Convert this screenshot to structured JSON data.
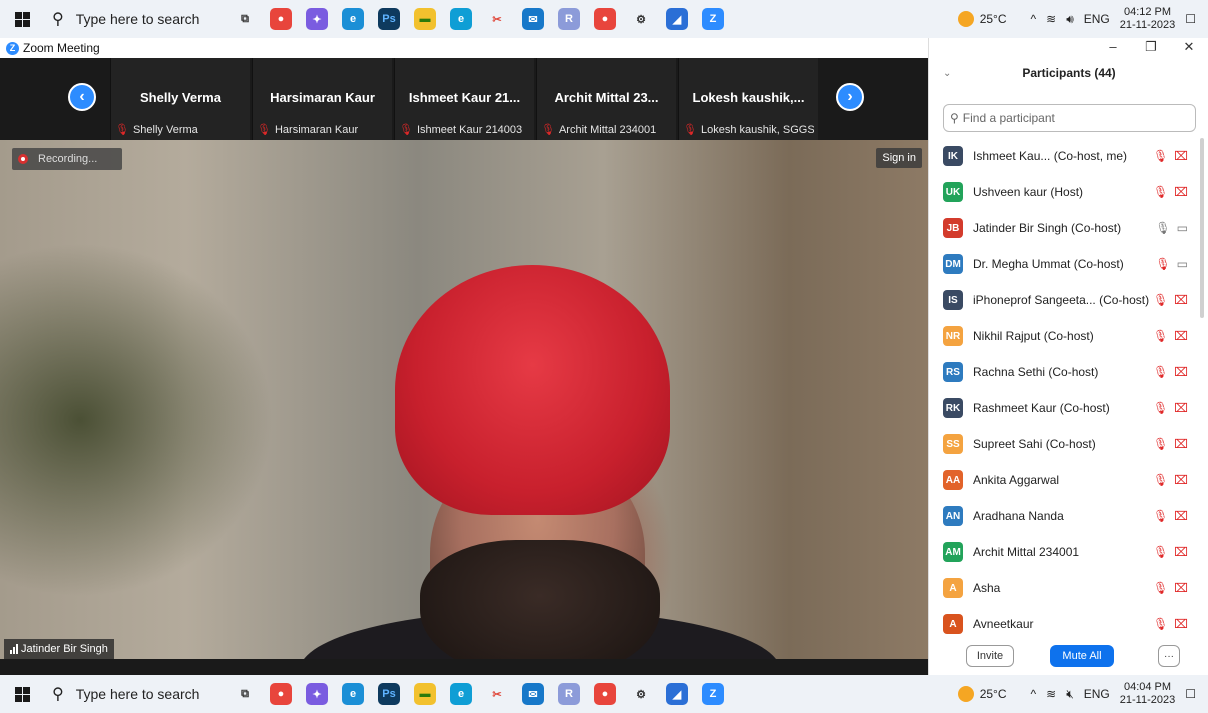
{
  "taskbar_top": {
    "search_placeholder": "Type here to search",
    "temperature": "25°C",
    "lang": "ENG",
    "time": "04:12 PM",
    "date": "21-11-2023"
  },
  "taskbar_bottom": {
    "search_placeholder": "Type here to search",
    "temperature": "25°C",
    "lang": "ENG",
    "time": "04:04 PM",
    "date": "21-11-2023"
  },
  "taskbar_icons": [
    "task-view-icon",
    "chrome-icon",
    "copilot-icon",
    "edge-icon",
    "photoshop-icon",
    "file-explorer-icon",
    "edge-browser-icon",
    "snipping-tool-icon",
    "mail-icon",
    "r-icon",
    "chrome-alt-icon",
    "settings-icon",
    "photos-icon",
    "zoom-icon"
  ],
  "window": {
    "title": "Zoom Meeting"
  },
  "strip": {
    "tiles": [
      {
        "name": "Shelly Verma",
        "label": "Shelly Verma"
      },
      {
        "name": "Harsimaran Kaur",
        "label": "Harsimaran Kaur"
      },
      {
        "name": "Ishmeet Kaur 21...",
        "label": "Ishmeet Kaur 214003"
      },
      {
        "name": "Archit Mittal 23...",
        "label": "Archit Mittal 234001"
      },
      {
        "name": "Lokesh kaushik,...",
        "label": "Lokesh kaushik, SGGS..."
      }
    ]
  },
  "video": {
    "recording_label": "Recording...",
    "signin_label": "Sign in",
    "speaker_name": "Jatinder Bir Singh"
  },
  "panel": {
    "title": "Participants (44)",
    "search_placeholder": "Find a participant",
    "participants": [
      {
        "initials": "IK",
        "name": "Ishmeet Kau...  (Co-host, me)",
        "color": "#3a4a63",
        "mic": "muted",
        "video": "off"
      },
      {
        "initials": "UK",
        "name": "Ushveen kaur (Host)",
        "color": "#22a35a",
        "mic": "muted",
        "video": "off"
      },
      {
        "initials": "JB",
        "name": "Jatinder Bir Singh (Co-host)",
        "color": "#d33b2c",
        "mic": "on",
        "video": "on"
      },
      {
        "initials": "DM",
        "name": "Dr. Megha Ummat (Co-host)",
        "color": "#2e7bbf",
        "mic": "muted",
        "video": "on"
      },
      {
        "initials": "IS",
        "name": "iPhoneprof Sangeeta... (Co-host)",
        "color": "#3a4a63",
        "mic": "muted",
        "video": "off"
      },
      {
        "initials": "NR",
        "name": "Nikhil Rajput (Co-host)",
        "color": "#f4a340",
        "mic": "muted",
        "video": "off"
      },
      {
        "initials": "RS",
        "name": "Rachna Sethi (Co-host)",
        "color": "#2e7bbf",
        "mic": "muted",
        "video": "off"
      },
      {
        "initials": "RK",
        "name": "Rashmeet Kaur (Co-host)",
        "color": "#3a4a63",
        "mic": "muted",
        "video": "off"
      },
      {
        "initials": "SS",
        "name": "Supreet Sahi (Co-host)",
        "color": "#f4a340",
        "mic": "muted",
        "video": "off"
      },
      {
        "initials": "AA",
        "name": "Ankita Aggarwal",
        "color": "#e2632a",
        "mic": "muted",
        "video": "off"
      },
      {
        "initials": "AN",
        "name": "Aradhana Nanda",
        "color": "#2e7bbf",
        "mic": "muted",
        "video": "off"
      },
      {
        "initials": "AM",
        "name": "Archit Mittal 234001",
        "color": "#22a35a",
        "mic": "muted",
        "video": "off"
      },
      {
        "initials": "A",
        "name": "Asha",
        "color": "#f4a340",
        "mic": "muted",
        "video": "off"
      },
      {
        "initials": "A",
        "name": "Avneetkaur",
        "color": "#d9531e",
        "mic": "muted",
        "video": "off"
      }
    ],
    "invite_label": "Invite",
    "mute_all_label": "Mute All",
    "more_label": "···"
  }
}
